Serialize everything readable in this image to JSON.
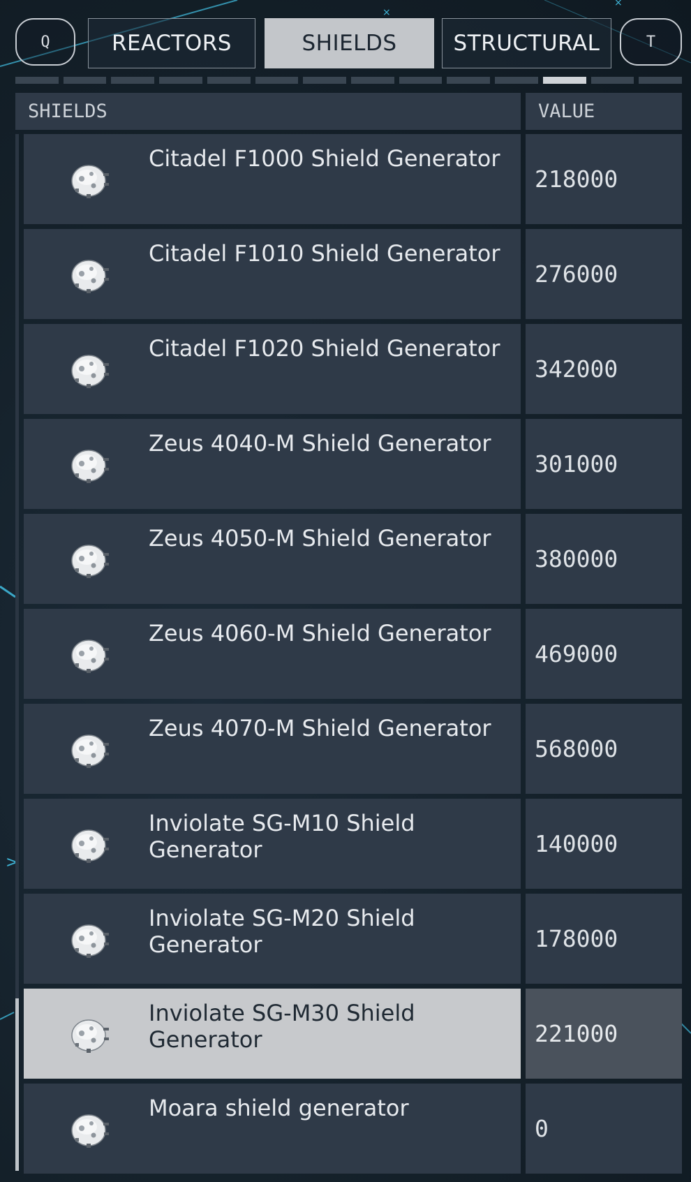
{
  "tabbar": {
    "left_key": "Q",
    "right_key": "T",
    "tabs": [
      {
        "label": "REACTORS",
        "active": false
      },
      {
        "label": "SHIELDS",
        "active": true
      },
      {
        "label": "STRUCTURAL",
        "active": false
      }
    ]
  },
  "pager": {
    "segment_count": 14,
    "active_index": 11
  },
  "table": {
    "header_name": "SHIELDS",
    "header_value": "VALUE",
    "rows": [
      {
        "name": "Citadel F1000 Shield Generator",
        "value": "218000",
        "selected": false
      },
      {
        "name": "Citadel F1010 Shield Generator",
        "value": "276000",
        "selected": false
      },
      {
        "name": "Citadel F1020 Shield Generator",
        "value": "342000",
        "selected": false
      },
      {
        "name": "Zeus 4040-M Shield Generator",
        "value": "301000",
        "selected": false
      },
      {
        "name": "Zeus 4050-M Shield Generator",
        "value": "380000",
        "selected": false
      },
      {
        "name": "Zeus 4060-M Shield Generator",
        "value": "469000",
        "selected": false
      },
      {
        "name": "Zeus 4070-M Shield Generator",
        "value": "568000",
        "selected": false
      },
      {
        "name": "Inviolate SG-M10 Shield Generator",
        "value": "140000",
        "selected": false
      },
      {
        "name": "Inviolate SG-M20 Shield Generator",
        "value": "178000",
        "selected": false
      },
      {
        "name": "Inviolate SG-M30 Shield Generator",
        "value": "221000",
        "selected": true
      },
      {
        "name": "Moara shield generator",
        "value": "0",
        "selected": false
      }
    ],
    "row_icon": "shield-generator-icon"
  },
  "colors": {
    "panel": "#2f3a48",
    "selected_row": "#c7c9cc",
    "active_tab": "#c3c6ca",
    "accent_line": "#3fb6d8"
  }
}
